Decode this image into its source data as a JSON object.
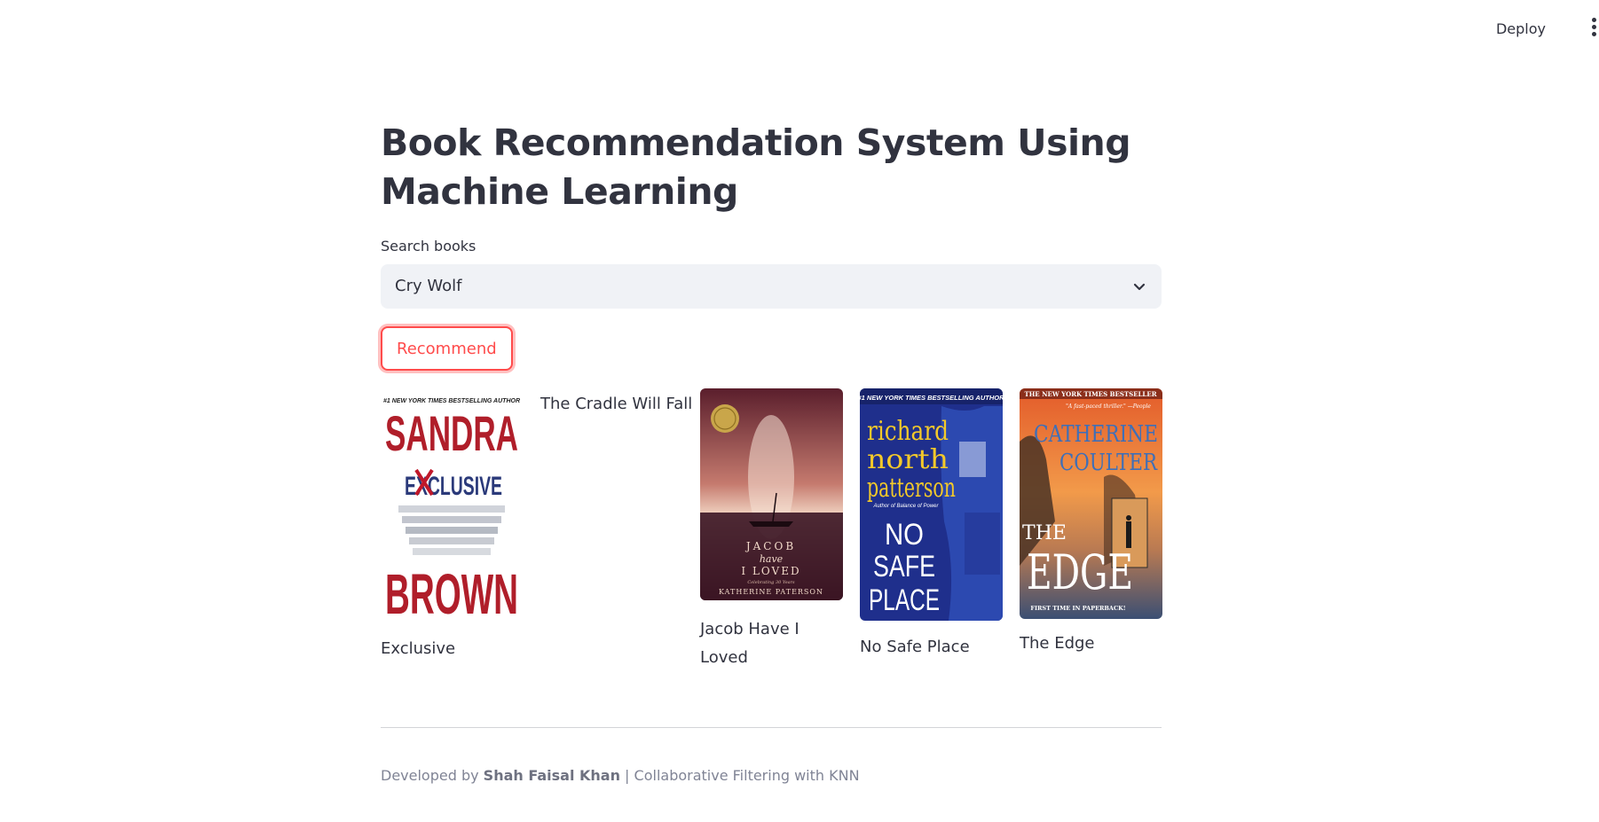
{
  "header": {
    "deploy_label": "Deploy",
    "menu_icon": "kebab-menu-icon"
  },
  "main": {
    "title_line1": "Book Recommendation System Using",
    "title_line2": "Machine Learning",
    "search": {
      "label": "Search books",
      "selected_value": "Cry Wolf",
      "icon": "chevron-down-icon"
    },
    "recommend_label": "Recommend"
  },
  "recommendations": [
    {
      "title": "Exclusive",
      "cover": {
        "has_image": true,
        "tagline": "#1 NEW YORK TIMES BESTSELLING AUTHOR",
        "line1": "SANDRA",
        "line2": "EXCLUSIVE",
        "line3": "BROWN"
      }
    },
    {
      "title": "The Cradle Will Fall",
      "cover": {
        "has_image": false
      }
    },
    {
      "title": "Jacob Have I Loved",
      "cover": {
        "has_image": true,
        "line1": "JACOB",
        "line2": "have",
        "line3": "I LOVED",
        "line4": "Celebrating 30 Years",
        "author": "KATHERINE PATERSON"
      }
    },
    {
      "title": "No Safe Place",
      "cover": {
        "has_image": true,
        "tagline": "#1 NEW YORK TIMES BESTSELLING AUTHOR",
        "author_line1": "richard",
        "author_line2": "north",
        "author_line3": "patterson",
        "subtag": "Author of Balance of Power",
        "line1": "NO",
        "line2": "SAFE",
        "line3": "PLACE"
      }
    },
    {
      "title": "The Edge",
      "cover": {
        "has_image": true,
        "tagline": "THE NEW YORK TIMES BESTSELLER",
        "quote": "\"A fast-paced thriller.\" —People",
        "author_line1": "CATHERINE",
        "author_line2": "COULTER",
        "line1": "THE",
        "line2": "EDGE",
        "bottom": "FIRST TIME IN PAPERBACK!"
      }
    }
  ],
  "footer": {
    "prefix": "Developed by ",
    "author": "Shah Faisal Khan",
    "suffix": " | Collaborative Filtering with KNN"
  },
  "colors": {
    "accent": "#ff4b4b",
    "text": "#31333f",
    "input_bg": "#f0f2f6",
    "muted": "#808495"
  }
}
